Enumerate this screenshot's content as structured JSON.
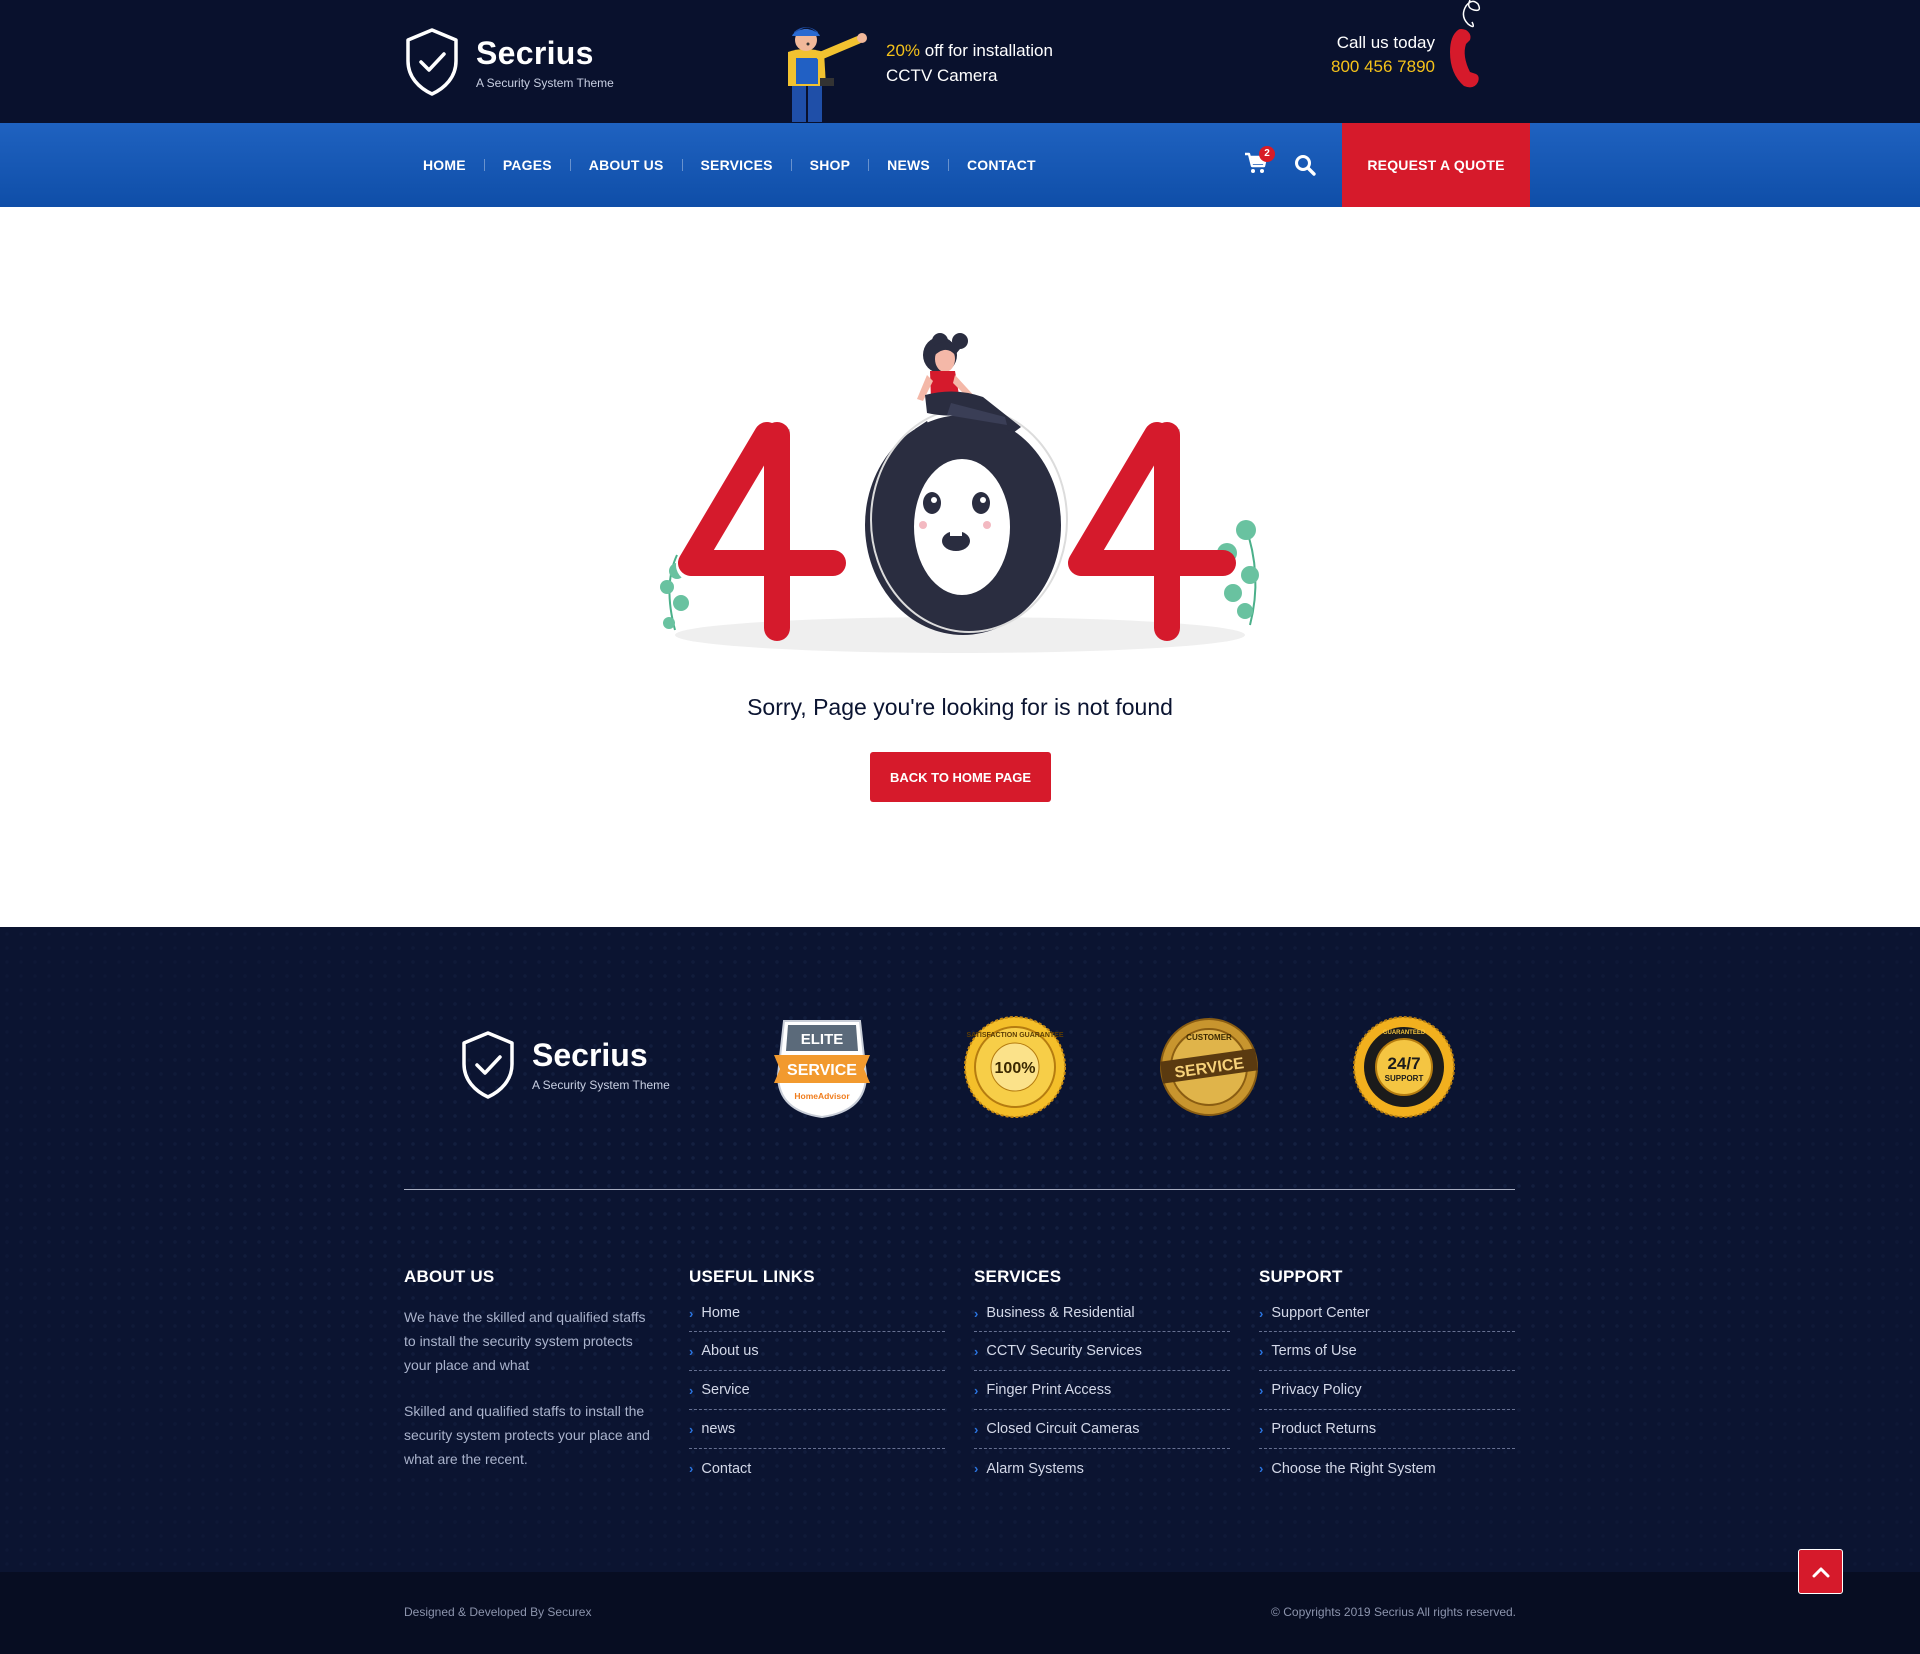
{
  "header": {
    "brand": {
      "name": "Secrius",
      "tagline": "A Security System Theme"
    },
    "promo": {
      "highlight": "20%",
      "line1_rest": " off for installation",
      "line2": "CCTV Camera"
    },
    "call": {
      "label": "Call us today",
      "number": "800 456 7890"
    }
  },
  "nav": {
    "items": [
      {
        "label": "HOME"
      },
      {
        "label": "PAGES"
      },
      {
        "label": "ABOUT US"
      },
      {
        "label": "SERVICES"
      },
      {
        "label": "SHOP"
      },
      {
        "label": "NEWS"
      },
      {
        "label": "CONTACT"
      }
    ],
    "cart_count": "2",
    "quote_label": "REQUEST A QUOTE"
  },
  "error": {
    "message": "Sorry, Page you're looking for is not found",
    "button_label": "BACK TO HOME PAGE"
  },
  "footer": {
    "brand": {
      "name": "Secrius",
      "tagline": "A Security System Theme"
    },
    "badges": {
      "elite": {
        "top": "ELITE",
        "main": "SERVICE",
        "sub": "HomeAdvisor"
      },
      "satisfaction": {
        "ring": "SATISFACTION GUARANTEE",
        "value": "100%"
      },
      "customer": {
        "ring": "CUSTOMER",
        "main": "SERVICE"
      },
      "support": {
        "ring": "GUARANTEED",
        "main": "24/7",
        "sub": "SUPPORT"
      }
    },
    "about": {
      "title": "ABOUT US",
      "p1": "We have the skilled and qualified staffs to install the security system protects your place and what",
      "p2": "Skilled and qualified staffs to install the security system protects your place and what are the recent."
    },
    "useful_links": {
      "title": "USEFUL LINKS",
      "items": [
        "Home",
        "About us",
        "Service",
        "news",
        "Contact"
      ]
    },
    "services": {
      "title": "SERVICES",
      "items": [
        "Business & Residential",
        "CCTV Security Services",
        "Finger Print Access",
        "Closed Circuit Cameras",
        "Alarm Systems"
      ]
    },
    "support": {
      "title": "SUPPORT",
      "items": [
        "Support Center",
        "Terms of Use",
        "Privacy Policy",
        "Product Returns",
        "Choose the Right System"
      ]
    },
    "bottom": {
      "left": "Designed & Developed By Securex",
      "right": "© Copyrights 2019 Secrius All rights reserved."
    }
  },
  "colors": {
    "header_bg": "#09112d",
    "nav_blue": "#1a5cba",
    "accent_red": "#d61a2b",
    "highlight_yellow": "#f5c21a",
    "footer_bg": "#0b1431"
  }
}
